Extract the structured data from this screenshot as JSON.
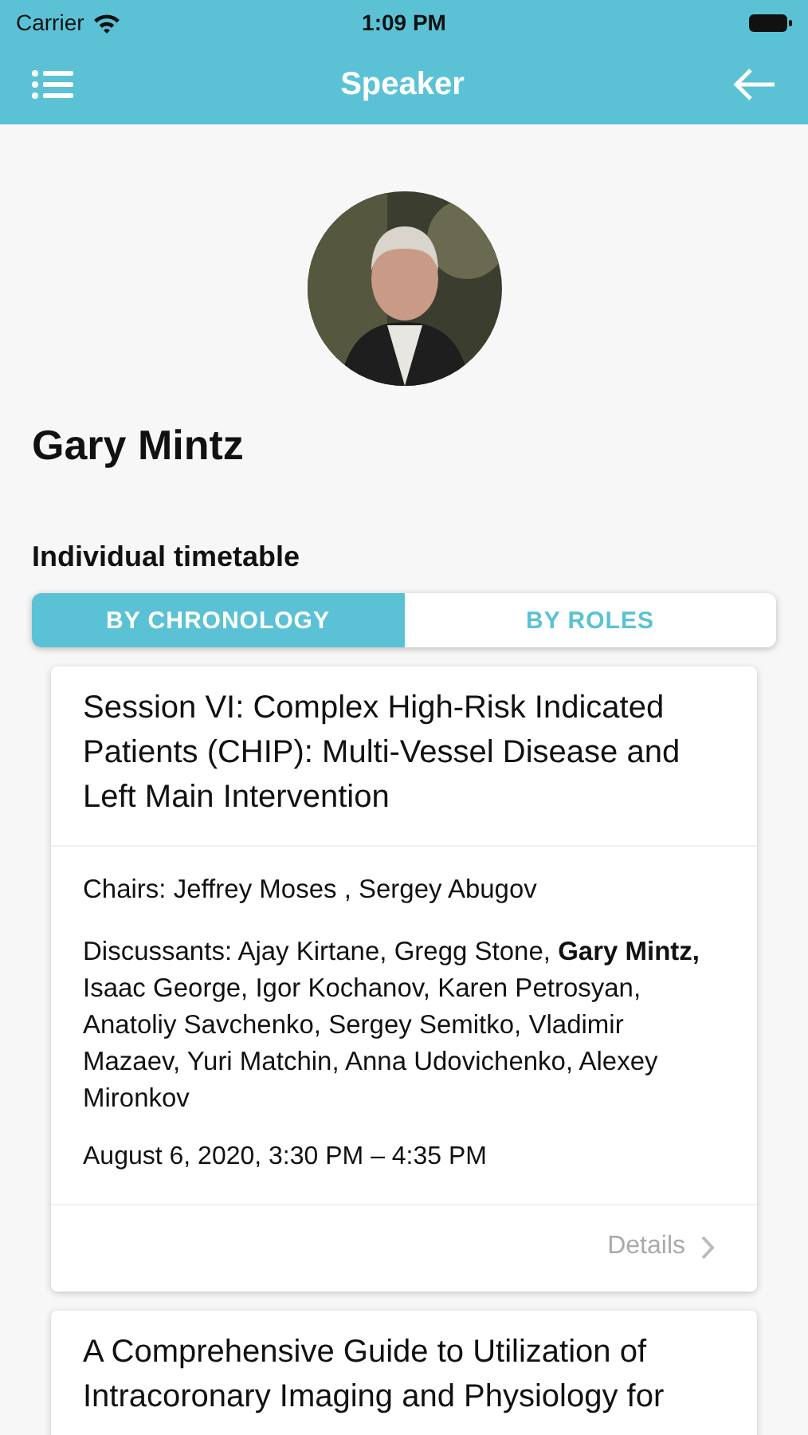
{
  "status_bar": {
    "carrier": "Carrier",
    "time": "1:09 PM"
  },
  "nav": {
    "title": "Speaker"
  },
  "speaker": {
    "name": "Gary Mintz"
  },
  "section_title": "Individual timetable",
  "tabs": [
    {
      "label": "BY CHRONOLOGY",
      "selected": true
    },
    {
      "label": "BY ROLES",
      "selected": false
    }
  ],
  "sessions": [
    {
      "title": "Session VI: Complex High-Risk Indicated Patients (CHIP): Multi-Vessel Disease and Left Main Intervention",
      "chairs": "Chairs: Jeffrey Moses , Sergey Abugov",
      "discussants": "Discussants: Ajay Kirtane, Gregg Stone, **Gary Mintz,** Isaac George, Igor Kochanov, Karen Petrosyan, Anatoliy Savchenko, Sergey Semitko, Vladimir Mazaev, Yuri Matchin, Anna Udovichenko, Alexey Mironkov",
      "time": "August 6, 2020, 3:30 PM – 4:35 PM",
      "details": "Details"
    },
    {
      "title": "A Comprehensive Guide to Utilization of Intracoronary Imaging and Physiology for"
    }
  ]
}
